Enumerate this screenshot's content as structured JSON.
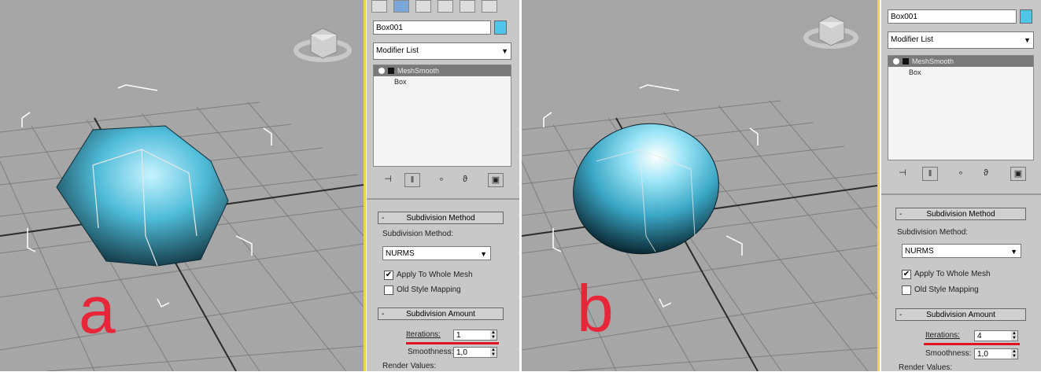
{
  "panels": [
    {
      "id": "a",
      "label": "a",
      "object_name": "Box001",
      "object_color": "#4fc6e8",
      "modifier_list": "Modifier List",
      "stack": {
        "selected": "MeshSmooth",
        "base": "Box"
      },
      "subdivision_method": {
        "rollout_title": "Subdivision Method",
        "label": "Subdivision Method:",
        "value": "NURMS",
        "apply_to_whole_mesh": "Apply To Whole Mesh",
        "apply_checked": true,
        "old_style_mapping": "Old Style Mapping",
        "old_checked": false
      },
      "subdivision_amount": {
        "rollout_title": "Subdivision Amount",
        "iterations_label": "Iterations:",
        "iterations_value": "1",
        "smoothness_label": "Smoothness:",
        "smoothness_value": "1,0",
        "render_values_label": "Render Values:"
      }
    },
    {
      "id": "b",
      "label": "b",
      "object_name": "Box001",
      "object_color": "#4fc6e8",
      "modifier_list": "Modifier List",
      "stack": {
        "selected": "MeshSmooth",
        "base": "Box"
      },
      "subdivision_method": {
        "rollout_title": "Subdivision Method",
        "label": "Subdivision Method:",
        "value": "NURMS",
        "apply_to_whole_mesh": "Apply To Whole Mesh",
        "apply_checked": true,
        "old_style_mapping": "Old Style Mapping",
        "old_checked": false
      },
      "subdivision_amount": {
        "rollout_title": "Subdivision Amount",
        "iterations_label": "Iterations:",
        "iterations_value": "4",
        "smoothness_label": "Smoothness:",
        "smoothness_value": "1,0",
        "render_values_label": "Render Values:"
      }
    }
  ],
  "icons": {
    "stack_pin": "pin-icon",
    "show_end_result": "show-end-result-icon",
    "make_unique": "make-unique-icon",
    "remove_modifier": "remove-modifier-icon",
    "configure_sets": "configure-modifier-sets-icon",
    "viewcube": "viewcube-icon"
  },
  "colors": {
    "viewport_bg": "#a6a6a6",
    "panel_bg": "#c8c8c8",
    "active_viewport_border": "#f0d34a",
    "object": "#4fc6e8",
    "annotation_red": "#e0141e"
  }
}
